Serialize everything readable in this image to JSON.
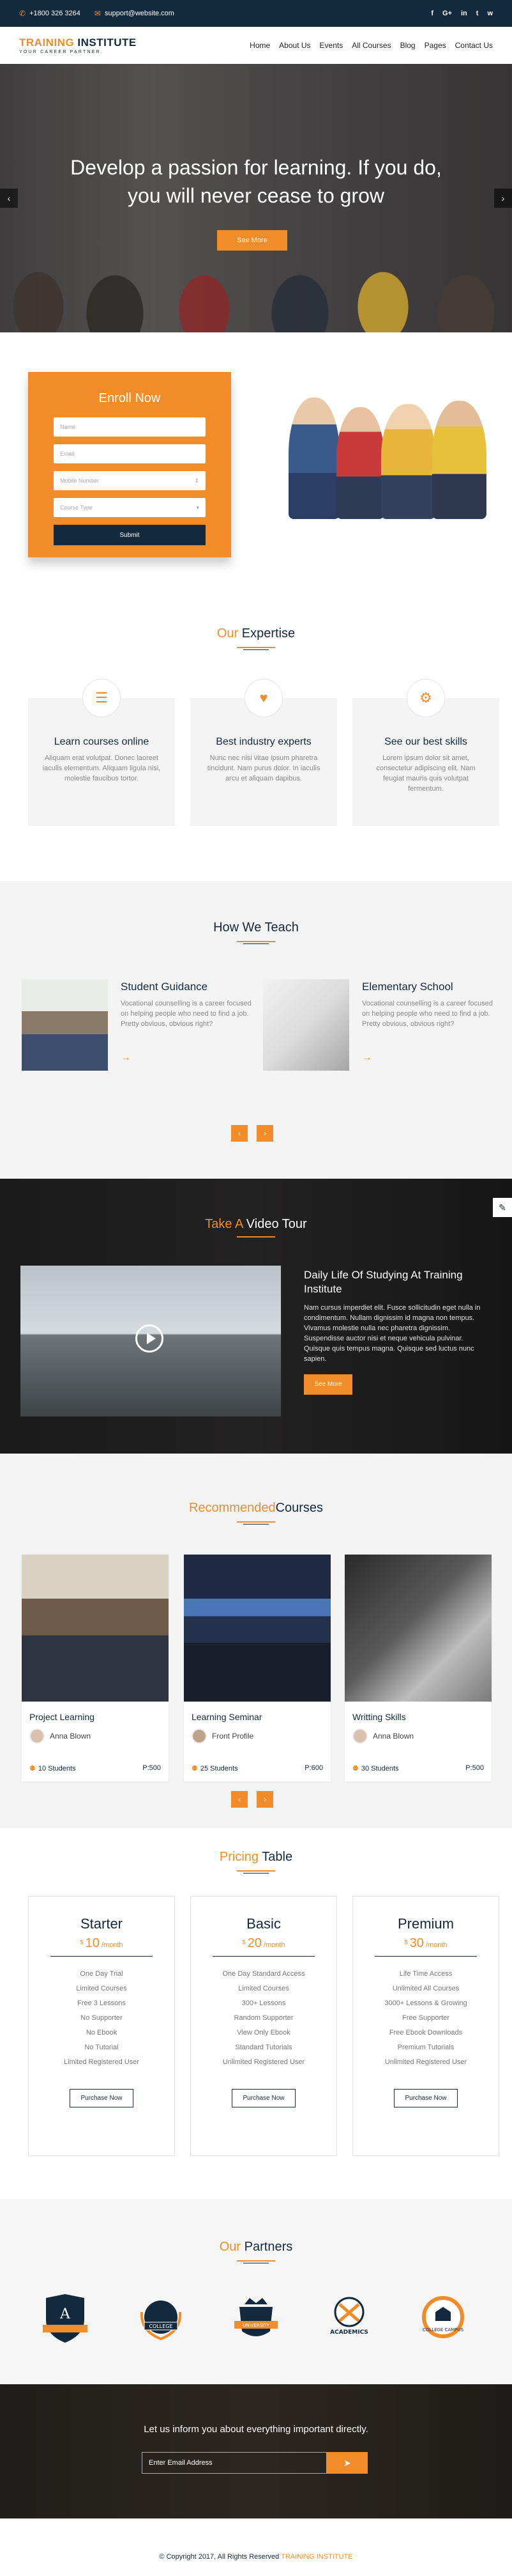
{
  "topbar": {
    "phone": "+1800 326 3264",
    "email": "support@website.com",
    "social": [
      "facebook-icon",
      "google-plus-icon",
      "linkedin-icon",
      "twitter-icon",
      "whatsapp-icon"
    ],
    "social_glyphs": [
      "f",
      "G+",
      "in",
      "t",
      "w"
    ]
  },
  "brand": {
    "name_part1": "TRAINING ",
    "name_part2": "INSTITUTE",
    "tagline": "YOUR CAREER PARTNER"
  },
  "nav": {
    "items": [
      "Home",
      "About Us",
      "Events",
      "All Courses",
      "Blog",
      "Pages",
      "Contact Us"
    ]
  },
  "hero": {
    "headline_line1": "Develop a passion for learning. If you do,",
    "headline_line2": "you will never cease to grow",
    "button": "See More",
    "prev": "‹",
    "next": "›"
  },
  "enroll": {
    "title": "Enroll Now",
    "name_placeholder": "Name",
    "email_placeholder": "Email",
    "mobile_placeholder": "Mobile Number",
    "course_placeholder": "Course Type",
    "submit": "Submit"
  },
  "expertise": {
    "title_o": "Our",
    "title_rest": " Expertise",
    "cards": [
      {
        "icon": "list-icon",
        "glyph": "☰",
        "title": "Learn courses online",
        "text": "Aliquam erat volutpat. Donec laoreet iaculis elementum. Aliquam ligula nisi, molestie faucibus tortor."
      },
      {
        "icon": "heart-icon",
        "glyph": "♥",
        "title": "Best industry experts",
        "text": "Nunc nec nisi vitae ipsum pharetra tincidunt. Nam purus dolor. In iaculis arcu et aliquam dapibus."
      },
      {
        "icon": "gear-icon",
        "glyph": "⚙",
        "title": "See our best skills",
        "text": "Lorem ipsum dolor sit amet, consectetur adipiscing elit. Nam feugiat mauris quis volutpat fermentum."
      }
    ]
  },
  "teach": {
    "title": "How We Teach",
    "items": [
      {
        "title": "Student Guidance",
        "text": "Vocational counselling is a career focused on helping people who need to find a job. Pretty obvious, obvious right?",
        "more": "→"
      },
      {
        "title": "Elementary School",
        "text": "Vocational counselling is a career focused on helping people who need to find a job. Pretty obvious, obvious right?",
        "more": "→"
      }
    ],
    "prev": "‹",
    "next": "›"
  },
  "video": {
    "title_o": "Take A",
    "title_rest": " Video Tour",
    "heading": "Daily Life Of Studying At Training Institute",
    "text": "Nam cursus imperdiet elit. Fusce sollicitudin eget nulla in condimentum. Nullam dignissim id magna non tempus. Vivamus molestie nulla nec pharetra dignissim. Suspendisse auctor nisi et neque vehicula pulvinar. Quisque quis tempus magna. Quisque sed luctus nunc sapien.",
    "button": "See More",
    "edit": "✎"
  },
  "courses": {
    "title_o": "Recommended",
    "title_rest": "Courses",
    "items": [
      {
        "title": "Project Learning",
        "author": "Anna Blown",
        "students": "10 Students",
        "price": "P:500"
      },
      {
        "title": "Learning Seminar",
        "author": "Front Profile",
        "students": "25 Students",
        "price": "P:600"
      },
      {
        "title": "Writting Skills",
        "author": "Anna Blown",
        "students": "30 Students",
        "price": "P:500"
      }
    ],
    "prev": "‹",
    "next": "›"
  },
  "pricing": {
    "title_o": "Pricing",
    "title_rest": " Table",
    "plans": [
      {
        "name": "Starter",
        "currency": "$",
        "amount": "10",
        "period": "/month",
        "features": [
          "One Day Trial",
          "Limited Courses",
          "Free 3 Lessons",
          "No Supporter",
          "No Ebook",
          "No Tutorial",
          "Limited Registered User"
        ],
        "button": "Purchase Now"
      },
      {
        "name": "Basic",
        "currency": "$",
        "amount": "20",
        "period": "/month",
        "features": [
          "One Day Standard Access",
          "Limited Courses",
          "300+ Lessons",
          "Random Supporter",
          "View Only Ebook",
          "Standard Tutorials",
          "Unlimited Registered User"
        ],
        "button": "Purchase Now"
      },
      {
        "name": "Premium",
        "currency": "$",
        "amount": "30",
        "period": "/month",
        "features": [
          "Life Time Access",
          "Unlimited All Courses",
          "3000+ Lessons & Growing",
          "Free Supporter",
          "Free Ebook Downloads",
          "Premium Tutorials",
          "Unlimited Registered User"
        ],
        "button": "Purchase Now"
      }
    ]
  },
  "partners": {
    "title_o": "Our",
    "title_rest": " Partners",
    "logos": [
      {
        "text": "A"
      },
      {
        "text": "COLLEGE"
      },
      {
        "text": "UNIVERSITY"
      },
      {
        "text": "ACADEMICS"
      },
      {
        "text": "COLLEGE CAMPUS"
      }
    ]
  },
  "subscribe": {
    "text": "Let us inform you about everything important directly.",
    "placeholder": "Enter Email Address",
    "send": "➤"
  },
  "footer": {
    "copyright": "© Copyright 2017, All Rights Reserved ",
    "brand": "TRAINING INSTITUTE"
  },
  "colors": {
    "accent": "#f28c28",
    "navy": "#13293d"
  }
}
